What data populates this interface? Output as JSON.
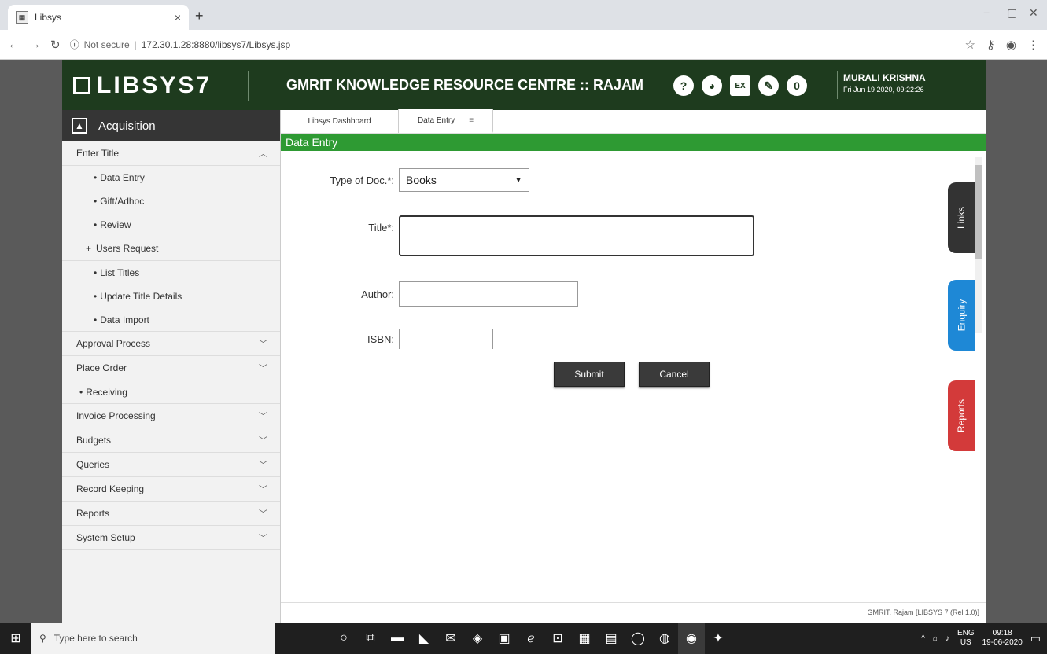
{
  "browser": {
    "tab_title": "Libsys",
    "tab_close": "×",
    "new_tab": "+",
    "security": "Not secure",
    "url": "172.30.1.28:8880/libsys7/Libsys.jsp",
    "win_min": "−",
    "win_max": "▢",
    "win_close": "✕"
  },
  "header": {
    "logo_text": "LIBSYS7",
    "org_title": "GMRIT KNOWLEDGE RESOURCE CENTRE :: RAJAM",
    "notification_count": "0",
    "user_name": "MURALI KRISHNA",
    "user_date": "Fri Jun 19 2020, 09:22:26"
  },
  "sidebar": {
    "module": "Acquisition",
    "enter_title": "Enter Title",
    "enter_title_subitems": [
      "Data Entry",
      "Gift/Adhoc",
      "Review"
    ],
    "users_request": "Users Request",
    "list_subitems": [
      "List Titles",
      "Update Title Details",
      "Data Import"
    ],
    "approval_process": "Approval Process",
    "place_order": "Place Order",
    "receiving": "Receiving",
    "rest_items": [
      "Invoice Processing",
      "Budgets",
      "Queries",
      "Record Keeping",
      "Reports",
      "System Setup"
    ]
  },
  "content": {
    "tabs": [
      "Libsys Dashboard",
      "Data Entry"
    ],
    "section_title": "Data Entry",
    "type_label": "Type of Doc.*:",
    "type_value": "Books",
    "title_label": "Title*:",
    "author_label": "Author:",
    "isbn_label": "ISBN:",
    "submit": "Submit",
    "cancel": "Cancel",
    "side_tabs": [
      "Links",
      "Enquiry",
      "Reports"
    ],
    "footer": "GMRIT, Rajam [LIBSYS 7 (Rel 1.0)]"
  },
  "taskbar": {
    "search_placeholder": "Type here to search",
    "lang": "ENG",
    "region": "US",
    "time": "09:18",
    "date": "19-06-2020"
  },
  "colors": {
    "header_bg": "#1e3b1e",
    "section_bar": "#2e9a33",
    "links_tab": "#333333",
    "enquiry_tab": "#1e88d6",
    "reports_tab": "#d33a3a"
  }
}
